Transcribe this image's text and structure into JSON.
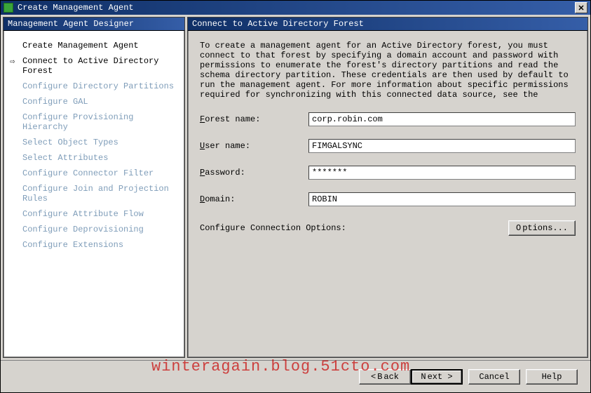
{
  "window": {
    "title": "Create Management Agent"
  },
  "left": {
    "header": "Management Agent Designer",
    "steps": [
      "Create Management Agent",
      "Connect to Active Directory Forest",
      "Configure Directory Partitions",
      "Configure GAL",
      "Configure Provisioning Hierarchy",
      "Select Object Types",
      "Select Attributes",
      "Configure Connector Filter",
      "Configure Join and Projection Rules",
      "Configure Attribute Flow",
      "Configure Deprovisioning",
      "Configure Extensions"
    ]
  },
  "right": {
    "header": "Connect to Active Directory Forest",
    "description": "To create a management agent for an Active Directory forest, you must connect to that forest by specifying a domain account and password with permissions to enumerate the forest's directory partitions and read the schema directory partition. These credentials are then used by default to run the management agent. For more information about specific permissions required for synchronizing with this connected data source, see the",
    "forest_label_pre": "F",
    "forest_label_post": "orest name:",
    "forest_value": "corp.robin.com",
    "user_label_pre": "U",
    "user_label_post": "ser name:",
    "user_value": "FIMGALSYNC",
    "password_label_pre": "P",
    "password_label_post": "assword:",
    "password_value": "*******",
    "domain_label_pre": "D",
    "domain_label_post": "omain:",
    "domain_value": "ROBIN",
    "conn_label": "Configure Connection Options:",
    "options_btn_pre": "O",
    "options_btn_post": "ptions..."
  },
  "footer": {
    "back_pre": "< ",
    "back_u": "B",
    "back_post": "ack",
    "next_u": "N",
    "next_post": "ext >",
    "cancel": "Cancel",
    "help": "Help"
  },
  "watermark": "winteragain.blog.51cto.com"
}
